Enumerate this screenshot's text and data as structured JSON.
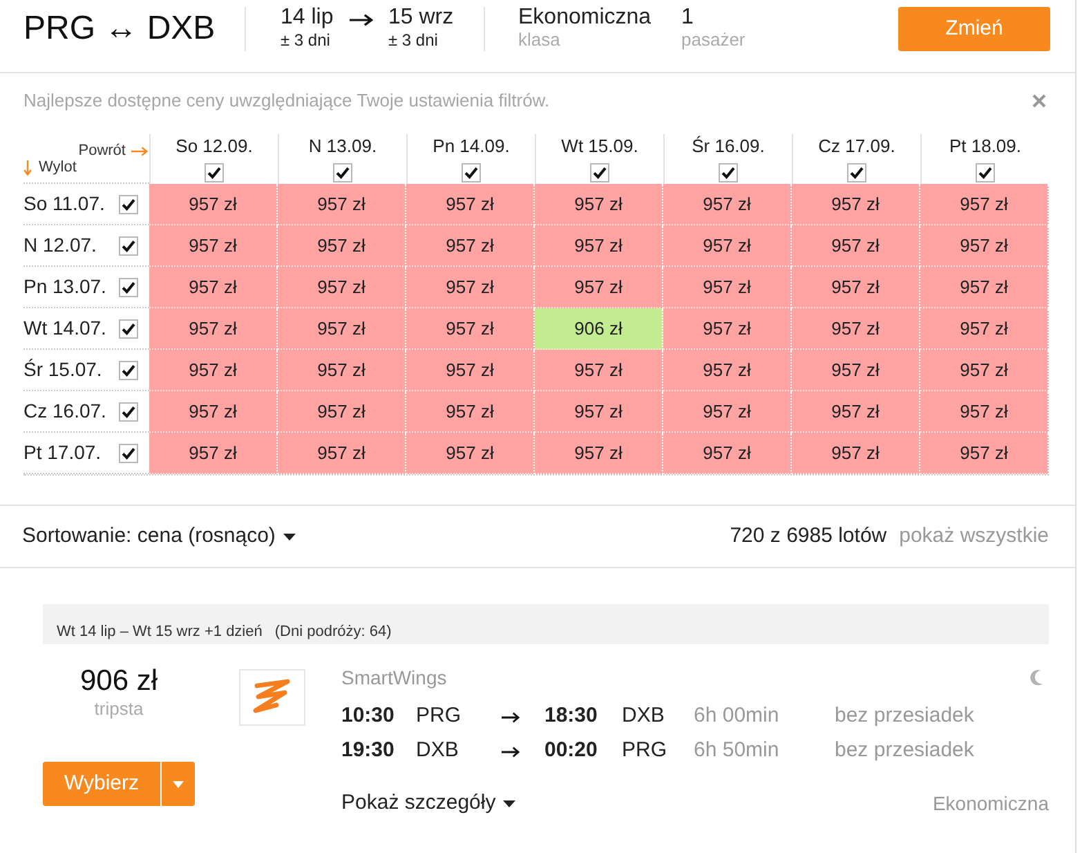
{
  "header": {
    "route": "PRG ↔ DXB",
    "dates": [
      {
        "date": "14 lip",
        "flex": "± 3 dni"
      },
      {
        "date": "15 wrz",
        "flex": "± 3 dni"
      }
    ],
    "cabin": {
      "value": "Ekonomiczna",
      "label": "klasa"
    },
    "passengers": {
      "value": "1",
      "label": "pasażer"
    },
    "change_button": "Zmień"
  },
  "notice": {
    "text": "Najlepsze dostępne ceny uwzględniające Twoje ustawienia filtrów."
  },
  "matrix": {
    "return_label": "Powrót",
    "departure_label": "Wylot",
    "columns": [
      {
        "label": "So 12.09.",
        "checked": true
      },
      {
        "label": "N 13.09.",
        "checked": true
      },
      {
        "label": "Pn 14.09.",
        "checked": true
      },
      {
        "label": "Wt 15.09.",
        "checked": true
      },
      {
        "label": "Śr 16.09.",
        "checked": true
      },
      {
        "label": "Cz 17.09.",
        "checked": true
      },
      {
        "label": "Pt 18.09.",
        "checked": true
      }
    ],
    "rows": [
      {
        "label": "So 11.07.",
        "checked": true,
        "cells": [
          {
            "price": "957 zł",
            "cheapest": false
          },
          {
            "price": "957 zł",
            "cheapest": false
          },
          {
            "price": "957 zł",
            "cheapest": false
          },
          {
            "price": "957 zł",
            "cheapest": false
          },
          {
            "price": "957 zł",
            "cheapest": false
          },
          {
            "price": "957 zł",
            "cheapest": false
          },
          {
            "price": "957 zł",
            "cheapest": false
          }
        ]
      },
      {
        "label": "N 12.07.",
        "checked": true,
        "cells": [
          {
            "price": "957 zł",
            "cheapest": false
          },
          {
            "price": "957 zł",
            "cheapest": false
          },
          {
            "price": "957 zł",
            "cheapest": false
          },
          {
            "price": "957 zł",
            "cheapest": false
          },
          {
            "price": "957 zł",
            "cheapest": false
          },
          {
            "price": "957 zł",
            "cheapest": false
          },
          {
            "price": "957 zł",
            "cheapest": false
          }
        ]
      },
      {
        "label": "Pn 13.07.",
        "checked": true,
        "cells": [
          {
            "price": "957 zł",
            "cheapest": false
          },
          {
            "price": "957 zł",
            "cheapest": false
          },
          {
            "price": "957 zł",
            "cheapest": false
          },
          {
            "price": "957 zł",
            "cheapest": false
          },
          {
            "price": "957 zł",
            "cheapest": false
          },
          {
            "price": "957 zł",
            "cheapest": false
          },
          {
            "price": "957 zł",
            "cheapest": false
          }
        ]
      },
      {
        "label": "Wt 14.07.",
        "checked": true,
        "cells": [
          {
            "price": "957 zł",
            "cheapest": false
          },
          {
            "price": "957 zł",
            "cheapest": false
          },
          {
            "price": "957 zł",
            "cheapest": false
          },
          {
            "price": "906 zł",
            "cheapest": true
          },
          {
            "price": "957 zł",
            "cheapest": false
          },
          {
            "price": "957 zł",
            "cheapest": false
          },
          {
            "price": "957 zł",
            "cheapest": false
          }
        ]
      },
      {
        "label": "Śr 15.07.",
        "checked": true,
        "cells": [
          {
            "price": "957 zł",
            "cheapest": false
          },
          {
            "price": "957 zł",
            "cheapest": false
          },
          {
            "price": "957 zł",
            "cheapest": false
          },
          {
            "price": "957 zł",
            "cheapest": false
          },
          {
            "price": "957 zł",
            "cheapest": false
          },
          {
            "price": "957 zł",
            "cheapest": false
          },
          {
            "price": "957 zł",
            "cheapest": false
          }
        ]
      },
      {
        "label": "Cz 16.07.",
        "checked": true,
        "cells": [
          {
            "price": "957 zł",
            "cheapest": false
          },
          {
            "price": "957 zł",
            "cheapest": false
          },
          {
            "price": "957 zł",
            "cheapest": false
          },
          {
            "price": "957 zł",
            "cheapest": false
          },
          {
            "price": "957 zł",
            "cheapest": false
          },
          {
            "price": "957 zł",
            "cheapest": false
          },
          {
            "price": "957 zł",
            "cheapest": false
          }
        ]
      },
      {
        "label": "Pt 17.07.",
        "checked": true,
        "cells": [
          {
            "price": "957 zł",
            "cheapest": false
          },
          {
            "price": "957 zł",
            "cheapest": false
          },
          {
            "price": "957 zł",
            "cheapest": false
          },
          {
            "price": "957 zł",
            "cheapest": false
          },
          {
            "price": "957 zł",
            "cheapest": false
          },
          {
            "price": "957 zł",
            "cheapest": false
          },
          {
            "price": "957 zł",
            "cheapest": false
          }
        ]
      }
    ]
  },
  "sort": {
    "label": "Sortowanie: cena (rosnąco)",
    "count": "720 z 6985 lotów",
    "show_all": "pokaż wszystkie"
  },
  "results": [
    {
      "dates": "Wt 14 lip – Wt 15 wrz +1 dzień",
      "trip_length": "(Dni podróży: 64)",
      "price": "906 zł",
      "provider": "tripsta",
      "select_button": "Wybierz",
      "airline": "SmartWings",
      "overnight": true,
      "legs": [
        {
          "depart_time": "10:30",
          "from": "PRG",
          "arrive_time": "18:30",
          "to": "DXB",
          "duration": "6h 00min",
          "stops": "bez przesiadek"
        },
        {
          "depart_time": "19:30",
          "from": "DXB",
          "arrive_time": "00:20",
          "to": "PRG",
          "duration": "6h 50min",
          "stops": "bez przesiadek"
        }
      ],
      "details_link": "Pokaż szczegóły",
      "cabin": "Ekonomiczna"
    }
  ]
}
